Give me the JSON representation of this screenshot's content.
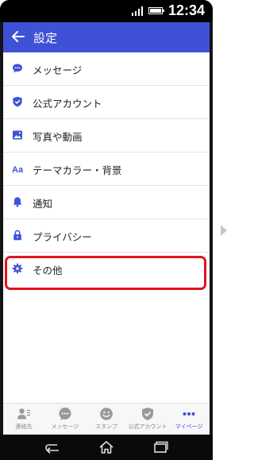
{
  "status_bar": {
    "time": "12:34"
  },
  "app_bar": {
    "title": "設定"
  },
  "settings": {
    "items": [
      {
        "label": "メッセージ",
        "icon": "chat-bubble-icon"
      },
      {
        "label": "公式アカウント",
        "icon": "shield-check-icon"
      },
      {
        "label": "写真や動画",
        "icon": "image-icon"
      },
      {
        "label": "テーマカラー・背景",
        "icon": "font-aa-icon"
      },
      {
        "label": "通知",
        "icon": "bell-icon"
      },
      {
        "label": "プライバシー",
        "icon": "lock-icon"
      },
      {
        "label": "その他",
        "icon": "gear-icon",
        "highlighted": true
      }
    ]
  },
  "tab_bar": {
    "tabs": [
      {
        "label": "連絡先",
        "icon": "contacts-icon"
      },
      {
        "label": "メッセージ",
        "icon": "chat-bubble-icon"
      },
      {
        "label": "スタンプ",
        "icon": "smiley-icon"
      },
      {
        "label": "公式アカウント",
        "icon": "shield-check-icon"
      },
      {
        "label": "マイページ",
        "icon": "more-dots-icon",
        "active": true
      }
    ]
  },
  "colors": {
    "accent": "#3f51d6",
    "highlight_border": "#e0141e",
    "tab_inactive": "#888888"
  }
}
